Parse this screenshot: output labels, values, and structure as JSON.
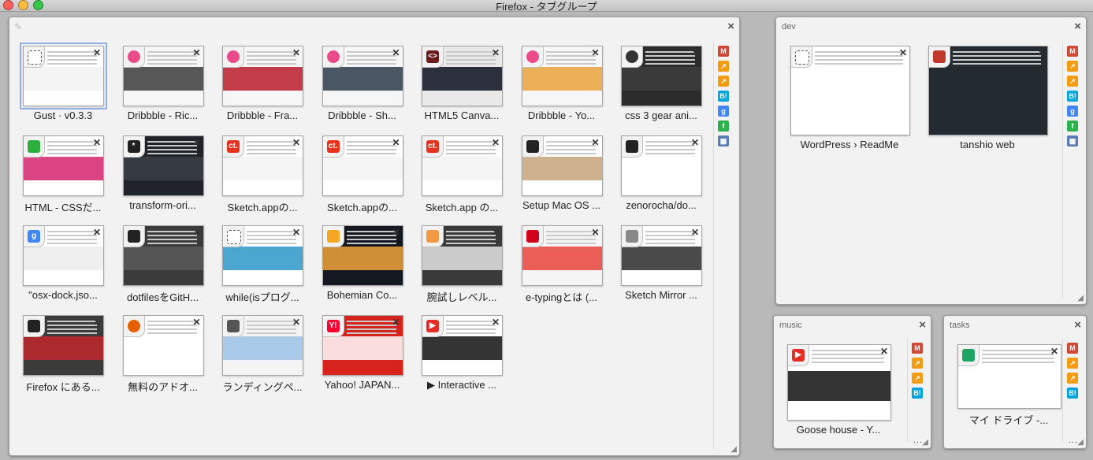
{
  "window": {
    "title": "Firefox - タブグループ"
  },
  "groups": [
    {
      "name": "",
      "tabs": [
        {
          "caption": "Gust · v0.3.3",
          "icon": "dotted-square-icon",
          "bg": "#ffffff",
          "band": "#f2f2f2",
          "color": "#ffffff",
          "fav": "#ffffff",
          "glyph": ""
        },
        {
          "caption": "Dribbble - Ric...",
          "icon": "dribbble-icon",
          "bg": "#f6f6f6",
          "band": "#3b3b3b",
          "color": "#ea4c89",
          "fav": "#ea4c89",
          "glyph": ""
        },
        {
          "caption": "Dribbble - Fra...",
          "icon": "dribbble-icon",
          "bg": "#f6f6f6",
          "band": "#b81c2a",
          "color": "#ea4c89",
          "fav": "#ea4c89",
          "glyph": ""
        },
        {
          "caption": "Dribbble - Sh...",
          "icon": "dribbble-icon",
          "bg": "#f6f6f6",
          "band": "#2b3a4a",
          "color": "#ea4c89",
          "fav": "#ea4c89",
          "glyph": ""
        },
        {
          "caption": "HTML5 Canva...",
          "icon": "html5-icon",
          "bg": "#e9e9e9",
          "band": "#0a0f1e",
          "color": "#6b1d1d",
          "fav": "#6b1d1d",
          "glyph": "<>"
        },
        {
          "caption": "Dribbble - Yo...",
          "icon": "dribbble-icon",
          "bg": "#f6f6f6",
          "band": "#e9a23b",
          "color": "#ea4c89",
          "fav": "#ea4c89",
          "glyph": ""
        },
        {
          "caption": "css 3 gear ani...",
          "icon": "gear-spinner-icon",
          "bg": "#2c2c2c",
          "band": "#3d3d3d",
          "color": "#333333",
          "fav": "#333333",
          "glyph": ""
        },
        {
          "caption": "HTML - CSSだ...",
          "icon": "leaf-icon",
          "bg": "#ffffff",
          "band": "#d6256f",
          "color": "#2eae3f",
          "fav": "#2eae3f",
          "glyph": ""
        },
        {
          "caption": "transform-ori...",
          "icon": "asterisk-icon",
          "bg": "#20242a",
          "band": "#3a3f45",
          "color": "#1f1f1f",
          "fav": "#1f1f1f",
          "glyph": "*"
        },
        {
          "caption": "Sketch.appの...",
          "icon": "ct-icon",
          "bg": "#ffffff",
          "band": "#f3f3f3",
          "color": "#e8321c",
          "fav": "#e8321c",
          "glyph": "ct."
        },
        {
          "caption": "Sketch.appの...",
          "icon": "ct-icon",
          "bg": "#ffffff",
          "band": "#f3f3f3",
          "color": "#e8321c",
          "fav": "#e8321c",
          "glyph": "ct."
        },
        {
          "caption": "Sketch.app の...",
          "icon": "ct-icon",
          "bg": "#ffffff",
          "band": "#f3f3f3",
          "color": "#e8321c",
          "fav": "#e8321c",
          "glyph": "ct."
        },
        {
          "caption": "Setup Mac OS ...",
          "icon": "github-icon",
          "bg": "#ffffff",
          "band": "#c8a37b",
          "color": "#222222",
          "fav": "#222222",
          "glyph": ""
        },
        {
          "caption": "zenorocha/do...",
          "icon": "github-icon",
          "bg": "#ffffff",
          "band": "#ffffff",
          "color": "#222222",
          "fav": "#222222",
          "glyph": ""
        },
        {
          "caption": "\"osx-dock.jso...",
          "icon": "google-icon",
          "bg": "#ffffff",
          "band": "#ececec",
          "color": "#4285f4",
          "fav": "#4285f4",
          "glyph": "g"
        },
        {
          "caption": "dotfilesをGitH...",
          "icon": "dotfiles-icon",
          "bg": "#3b3b3b",
          "band": "#5b5b5b",
          "color": "#222222",
          "fav": "#222222",
          "glyph": ""
        },
        {
          "caption": "while(isプログ...",
          "icon": "dotted-square-icon",
          "bg": "#ffffff",
          "band": "#2c96c8",
          "color": "#ffffff",
          "fav": "#ffffff",
          "glyph": ""
        },
        {
          "caption": "Bohemian Co...",
          "icon": "sketch-icon",
          "bg": "#141821",
          "band": "#f0a53a",
          "color": "#f5a623",
          "fav": "#f5a623",
          "glyph": ""
        },
        {
          "caption": "腕試しレベル...",
          "icon": "face-icon",
          "bg": "#3a3a3a",
          "band": "#e5e5e5",
          "color": "#f19a44",
          "fav": "#f19a44",
          "glyph": ""
        },
        {
          "caption": "e-typingとは (...",
          "icon": "robot-icon",
          "bg": "#f5f5f5",
          "band": "#e9433b",
          "color": "#d0021b",
          "fav": "#d0021b",
          "glyph": ""
        },
        {
          "caption": "Sketch Mirror ...",
          "icon": "apple-icon",
          "bg": "#ffffff",
          "band": "#2a2a2a",
          "color": "#888888",
          "fav": "#888888",
          "glyph": ""
        },
        {
          "caption": "Firefox にある...",
          "icon": "dotfiles-icon",
          "bg": "#3b3b3b",
          "band": "#c1272d",
          "color": "#222222",
          "fav": "#222222",
          "glyph": ""
        },
        {
          "caption": "無料のアドオ...",
          "icon": "firefox-icon",
          "bg": "#ffffff",
          "band": "#ffffff",
          "color": "#e66000",
          "fav": "#e66000",
          "glyph": ""
        },
        {
          "caption": "ランディングペ...",
          "icon": "character-icon",
          "bg": "#f4f4f4",
          "band": "#9bc3e6",
          "color": "#555555",
          "fav": "#555555",
          "glyph": ""
        },
        {
          "caption": "Yahoo! JAPAN...",
          "icon": "yahoo-icon",
          "bg": "#d6241d",
          "band": "#ffffff",
          "color": "#ff0033",
          "fav": "#ff0033",
          "glyph": "Y!"
        },
        {
          "caption": "▶ Interactive ...",
          "icon": "youtube-icon",
          "bg": "#ffffff",
          "band": "#111111",
          "color": "#e52d27",
          "fav": "#e52d27",
          "glyph": "▶"
        }
      ],
      "sidebar": [
        "gmail-icon",
        "chart-icon",
        "chart-icon",
        "hatena-icon",
        "google-icon",
        "feedly-icon",
        "calendar-icon"
      ]
    },
    {
      "name": "dev",
      "tabs": [
        {
          "caption": "WordPress › ReadMe",
          "icon": "dotted-square-icon",
          "bg": "#ffffff",
          "band": "#ffffff",
          "color": "#ffffff",
          "fav": "#ffffff",
          "glyph": ""
        },
        {
          "caption": "tanshio web",
          "icon": "hat-icon",
          "bg": "#232a30",
          "band": "#232a30",
          "color": "#c0392b",
          "fav": "#c0392b",
          "glyph": ""
        }
      ],
      "sidebar": [
        "gmail-icon",
        "chart-icon",
        "chart-icon",
        "hatena-icon",
        "google-icon",
        "feedly-icon",
        "calendar-icon"
      ]
    },
    {
      "name": "music",
      "tabs": [
        {
          "caption": "Goose house - Y...",
          "icon": "youtube-icon",
          "bg": "#ffffff",
          "band": "#111111",
          "color": "#e52d27",
          "fav": "#e52d27",
          "glyph": "▶"
        }
      ],
      "sidebar": [
        "gmail-icon",
        "chart-icon",
        "chart-icon",
        "hatena-icon"
      ],
      "more": "..."
    },
    {
      "name": "tasks",
      "tabs": [
        {
          "caption": "マイ ドライブ -...",
          "icon": "drive-icon",
          "bg": "#ffffff",
          "band": "#ffffff",
          "color": "#1fa463",
          "fav": "#1fa463",
          "glyph": ""
        }
      ],
      "sidebar": [
        "gmail-icon",
        "chart-icon",
        "chart-icon",
        "hatena-icon"
      ],
      "more": "..."
    }
  ],
  "sidebar_icon_colors": {
    "gmail-icon": "#d14836",
    "chart-icon": "#f39c12",
    "hatena-icon": "#00a4de",
    "google-icon": "#4285f4",
    "feedly-icon": "#2bb24c",
    "calendar-icon": "#5b7db1"
  },
  "sidebar_icon_glyphs": {
    "gmail-icon": "M",
    "chart-icon": "↗",
    "hatena-icon": "B!",
    "google-icon": "g",
    "feedly-icon": "f",
    "calendar-icon": "▦"
  }
}
